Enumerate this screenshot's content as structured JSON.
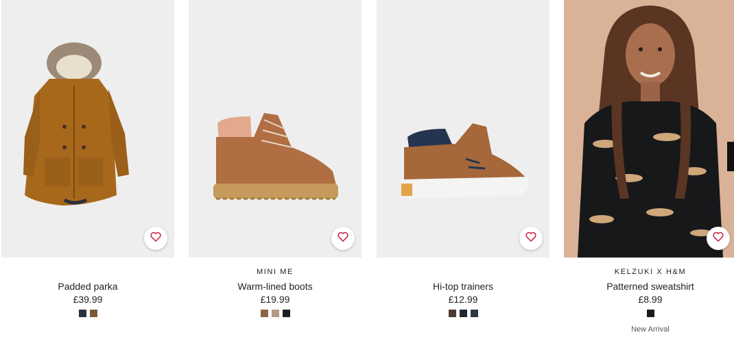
{
  "products": [
    {
      "brand": "",
      "title": "Padded parka",
      "price": "£39.99",
      "image_icon": "parka-image",
      "swatches": [
        "#2b3040",
        "#7a5a35"
      ],
      "badge": ""
    },
    {
      "brand": "MINI ME",
      "title": "Warm-lined boots",
      "price": "£19.99",
      "image_icon": "boots-image",
      "swatches": [
        "#8a6244",
        "#b99882",
        "#1e1e22"
      ],
      "badge": ""
    },
    {
      "brand": "",
      "title": "Hi-top trainers",
      "price": "£12.99",
      "image_icon": "trainers-image",
      "swatches": [
        "#4a3a30",
        "#22262e",
        "#2c3446"
      ],
      "badge": ""
    },
    {
      "brand": "KELZUKI X H&M",
      "title": "Patterned sweatshirt",
      "price": "£8.99",
      "image_icon": "sweatshirt-model-image",
      "swatches": [
        "#1b1b1d"
      ],
      "badge": "New Arrival"
    }
  ],
  "colors": {
    "favourite_icon": "#c8102e",
    "image_background": "#eeeeee"
  }
}
